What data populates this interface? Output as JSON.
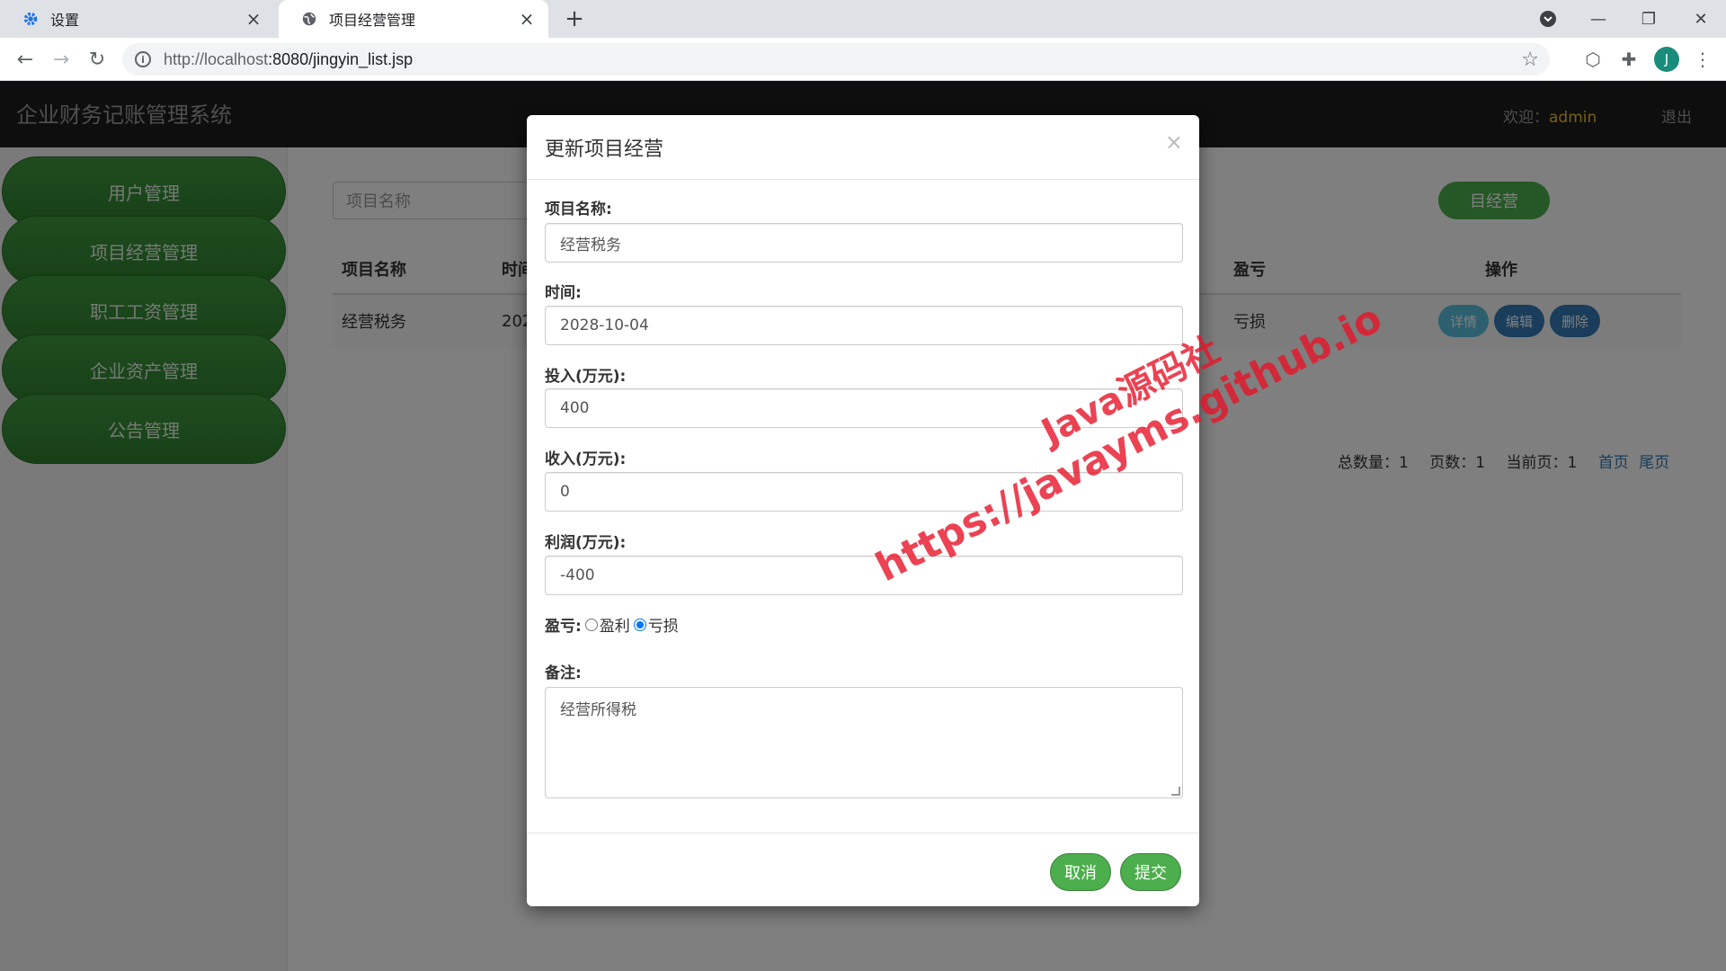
{
  "browser": {
    "tabs": [
      {
        "title": "设置",
        "icon": "gear-icon"
      },
      {
        "title": "项目经营管理",
        "icon": "globe-icon"
      }
    ],
    "url_host": "http://localhost",
    "url_rest": ":8080/jingyin_list.jsp",
    "profile_initial": "J"
  },
  "app": {
    "title": "企业财务记账管理系统",
    "welcome_label": "欢迎：",
    "username": "admin",
    "logout": "退出"
  },
  "sidebar": {
    "items": [
      {
        "label": "用户管理"
      },
      {
        "label": "项目经营管理"
      },
      {
        "label": "职工工资管理"
      },
      {
        "label": "企业资产管理"
      },
      {
        "label": "公告管理"
      }
    ]
  },
  "list": {
    "search_placeholder": "项目名称",
    "add_button": "目经营",
    "headers": {
      "name": "项目名称",
      "time": "时间",
      "profit_loss": "盈亏",
      "actions": "操作"
    },
    "rows": [
      {
        "name": "经营税务",
        "time": "202",
        "profit_loss": "亏损"
      }
    ],
    "row_buttons": {
      "detail": "详情",
      "edit": "编辑",
      "delete": "删除"
    },
    "pager": {
      "total": "总数量：1",
      "pages": "页数：1",
      "current": "当前页：1",
      "first": "首页",
      "last": "尾页"
    }
  },
  "modal": {
    "title": "更新项目经营",
    "close": "×",
    "fields": {
      "name_label": "项目名称:",
      "name_value": "经营税务",
      "time_label": "时间:",
      "time_value": "2028-10-04",
      "invest_label": "投入(万元):",
      "invest_value": "400",
      "income_label": "收入(万元):",
      "income_value": "0",
      "profit_label": "利润(万元):",
      "profit_value": "-400",
      "pl_label": "盈亏:",
      "pl_option_gain": "盈利",
      "pl_option_loss": "亏损",
      "pl_selected": "亏损",
      "note_label": "备注:",
      "note_value": "经营所得税"
    },
    "cancel": "取消",
    "submit": "提交"
  },
  "watermark": {
    "line1": "Java源码社",
    "line2": "https://javayms.github.io"
  }
}
